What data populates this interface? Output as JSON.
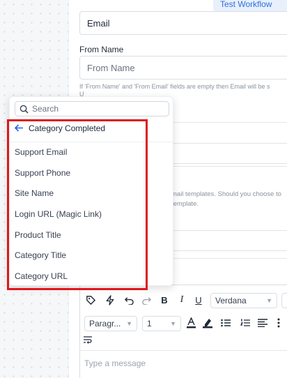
{
  "header": {
    "test_workflow_label": "Test Workflow"
  },
  "form": {
    "email_select_value": "Email",
    "from_name_label": "From Name",
    "from_name_placeholder": "From Name",
    "help_line1": "If 'From Name' and 'From Email' fields are empty then Email will be s",
    "help_line2": "U",
    "note_line1": "mail templates. Should you choose to",
    "note_line2": "template."
  },
  "dropdown": {
    "search_placeholder": "Search",
    "header_label": "Category Completed",
    "items": [
      "Support Email",
      "Support Phone",
      "Site Name",
      "Login URL (Magic Link)",
      "Product Title",
      "Category Title",
      "Category URL"
    ]
  },
  "editor": {
    "font_family": "Verdana",
    "paragraph": "Paragr...",
    "font_size": "1",
    "bold": "B",
    "italic": "I",
    "underline": "U",
    "placeholder": "Type a message"
  },
  "colors": {
    "accent": "#2563eb",
    "highlight": "#e0161b"
  }
}
